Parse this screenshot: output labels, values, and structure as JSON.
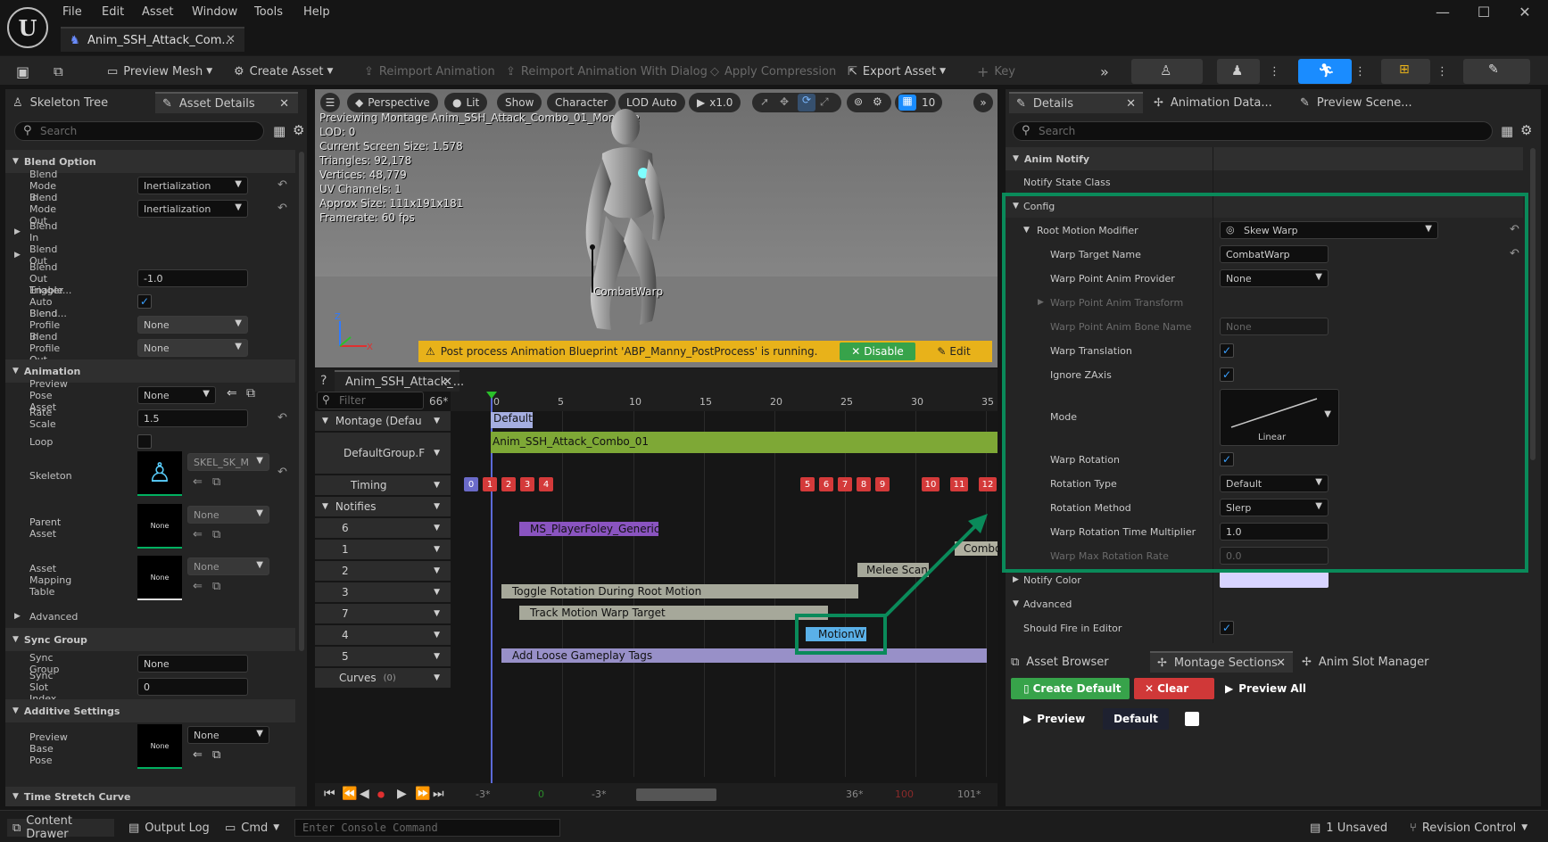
{
  "menu": {
    "items": [
      "File",
      "Edit",
      "Asset",
      "Window",
      "Tools",
      "Help"
    ],
    "tab_title": "Anim_SSH_Attack_Com..."
  },
  "toolbar": {
    "preview_mesh": "Preview Mesh",
    "create_asset": "Create Asset",
    "reimport_animation": "Reimport Animation",
    "reimport_dialog": "Reimport Animation With Dialog",
    "apply_compression": "Apply Compression",
    "export_asset": "Export Asset",
    "key": "Key"
  },
  "left": {
    "tabs": [
      "Skeleton Tree",
      "Asset Details"
    ],
    "search_placeholder": "Search",
    "blend_option": "Blend Option",
    "rows": {
      "blend_mode_in": "Blend Mode In",
      "blend_mode_in_val": "Inertialization",
      "blend_mode_out": "Blend Mode Out",
      "blend_mode_out_val": "Inertialization",
      "blend_in": "Blend In",
      "blend_out": "Blend Out",
      "blend_out_trigger": "Blend Out Trigger...",
      "blend_out_trigger_val": "-1.0",
      "enable_auto_blend": "Enable Auto Blend...",
      "blend_profile_in": "Blend Profile In",
      "blend_profile_in_val": "None",
      "blend_profile_out": "Blend Profile Out",
      "blend_profile_out_val": "None"
    },
    "animation": "Animation",
    "anim_rows": {
      "preview_pose_asset": "Preview Pose Asset",
      "preview_pose_asset_val": "None",
      "rate_scale": "Rate Scale",
      "rate_scale_val": "1.5",
      "loop": "Loop",
      "skeleton": "Skeleton",
      "skeleton_val": "SKEL_SK_M",
      "parent_asset": "Parent Asset",
      "parent_asset_val": "None",
      "parent_thumb": "None",
      "asset_mapping_table": "Asset Mapping Table",
      "asset_mapping_val": "None",
      "mapping_thumb": "None",
      "advanced": "Advanced"
    },
    "sync_group": "Sync Group",
    "sync_rows": {
      "sync_group": "Sync Group",
      "sync_group_val": "None",
      "sync_slot_index": "Sync Slot Index",
      "sync_slot_index_val": "0"
    },
    "additive": "Additive Settings",
    "additive_rows": {
      "preview_base_pose": "Preview Base Pose",
      "preview_base_pose_val": "None",
      "base_thumb": "None"
    },
    "time_stretch": "Time Stretch Curve"
  },
  "viewport": {
    "perspective": "Perspective",
    "lit": "Lit",
    "show": "Show",
    "character": "Character",
    "lod": "LOD Auto",
    "speed": "x1.0",
    "grid": "10",
    "stats": [
      "Previewing Montage Anim_SSH_Attack_Combo_01_Montage",
      "LOD: 0",
      "Current Screen Size: 1.578",
      "Triangles: 92,178",
      "Vertices: 48,779",
      "UV Channels: 1",
      "Approx Size: 111x191x181",
      "Framerate: 60 fps"
    ],
    "warp_label": "CombatWarp",
    "warning": "Post process Animation Blueprint 'ABP_Manny_PostProcess' is running.",
    "disable": "Disable",
    "edit": "Edit"
  },
  "timeline": {
    "tab": "Anim_SSH_Attack_...",
    "filter_placeholder": "Filter",
    "frame": "66*",
    "ruler": [
      "0",
      "5",
      "10",
      "15",
      "20",
      "25",
      "30",
      "35"
    ],
    "montage": "Montage (Defau",
    "group": "DefaultGroup.F",
    "timing": "Timing",
    "notifies": "Notifies",
    "curves": "Curves",
    "curves_count": "(0)",
    "tracks": [
      "6",
      "1",
      "2",
      "3",
      "7",
      "4",
      "5"
    ],
    "section": "Default",
    "segment": "Anim_SSH_Attack_Combo_01",
    "timing_nums": [
      "0",
      "1",
      "2",
      "3",
      "4",
      "5",
      "6",
      "7",
      "8",
      "9",
      "10",
      "11",
      "12"
    ],
    "notify_items": {
      "foley": "MS_PlayerFoley_Generic",
      "combo": "Combo",
      "melee": "Melee Scan",
      "toggle": "Toggle Rotation During Root Motion",
      "track": "Track Motion Warp Target",
      "motion": "MotionW",
      "loose": "Add Loose Gameplay Tags"
    },
    "bottom": {
      "start": "-3*",
      "zero": "0",
      "neg": "-3*",
      "mid": "36*",
      "red": "100",
      "end": "101*"
    }
  },
  "details": {
    "tabs": [
      "Details",
      "Animation Data...",
      "Preview Scene..."
    ],
    "search_placeholder": "Search",
    "anim_notify": "Anim Notify",
    "notify_state_class": "Notify State Class",
    "config": "Config",
    "root_motion_modifier": "Root Motion Modifier",
    "root_motion_modifier_val": "Skew Warp",
    "warp_target_name": "Warp Target Name",
    "warp_target_name_val": "CombatWarp",
    "warp_point_provider": "Warp Point Anim Provider",
    "warp_point_provider_val": "None",
    "warp_point_transform": "Warp Point Anim Transform",
    "warp_point_bone": "Warp Point Anim Bone Name",
    "warp_point_bone_val": "None",
    "warp_translation": "Warp Translation",
    "ignore_zaxis": "Ignore ZAxis",
    "mode": "Mode",
    "mode_val": "Linear",
    "warp_rotation": "Warp Rotation",
    "rotation_type": "Rotation Type",
    "rotation_type_val": "Default",
    "rotation_method": "Rotation Method",
    "rotation_method_val": "Slerp",
    "warp_rot_mult": "Warp Rotation Time Multiplier",
    "warp_rot_mult_val": "1.0",
    "warp_max_rate": "Warp Max Rotation Rate",
    "warp_max_rate_val": "0.0",
    "notify_color": "Notify Color",
    "notify_color_hex": "#d8d4ff",
    "advanced": "Advanced",
    "should_fire": "Should Fire in Editor"
  },
  "sections": {
    "tabs": [
      "Asset Browser",
      "Montage Sections",
      "Anim Slot Manager"
    ],
    "create_default": "Create Default",
    "clear": "Clear",
    "preview_all": "Preview All",
    "preview": "Preview",
    "default": "Default"
  },
  "status": {
    "content_drawer": "Content Drawer",
    "output_log": "Output Log",
    "cmd": "Cmd",
    "console_placeholder": "Enter Console Command",
    "unsaved": "1 Unsaved",
    "revision": "Revision Control"
  },
  "colors": {
    "highlight": "#0a8a5a",
    "accent": "#1a8cff",
    "warning": "#e8b21a",
    "green_bar": "#7ea836",
    "section": "#a5aee0"
  }
}
